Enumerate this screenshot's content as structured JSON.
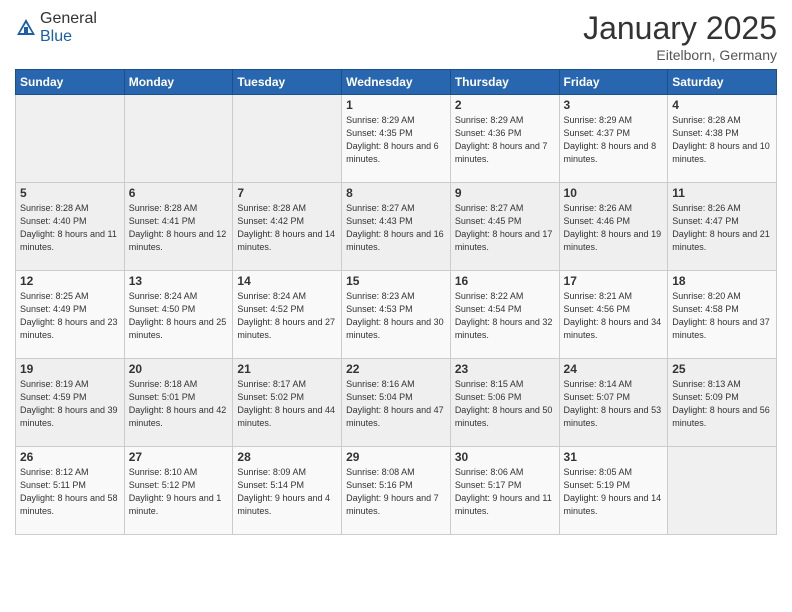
{
  "header": {
    "logo_general": "General",
    "logo_blue": "Blue",
    "month": "January 2025",
    "location": "Eitelborn, Germany"
  },
  "weekdays": [
    "Sunday",
    "Monday",
    "Tuesday",
    "Wednesday",
    "Thursday",
    "Friday",
    "Saturday"
  ],
  "weeks": [
    [
      {
        "day": "",
        "info": ""
      },
      {
        "day": "",
        "info": ""
      },
      {
        "day": "",
        "info": ""
      },
      {
        "day": "1",
        "info": "Sunrise: 8:29 AM\nSunset: 4:35 PM\nDaylight: 8 hours\nand 6 minutes."
      },
      {
        "day": "2",
        "info": "Sunrise: 8:29 AM\nSunset: 4:36 PM\nDaylight: 8 hours\nand 7 minutes."
      },
      {
        "day": "3",
        "info": "Sunrise: 8:29 AM\nSunset: 4:37 PM\nDaylight: 8 hours\nand 8 minutes."
      },
      {
        "day": "4",
        "info": "Sunrise: 8:28 AM\nSunset: 4:38 PM\nDaylight: 8 hours\nand 10 minutes."
      }
    ],
    [
      {
        "day": "5",
        "info": "Sunrise: 8:28 AM\nSunset: 4:40 PM\nDaylight: 8 hours\nand 11 minutes."
      },
      {
        "day": "6",
        "info": "Sunrise: 8:28 AM\nSunset: 4:41 PM\nDaylight: 8 hours\nand 12 minutes."
      },
      {
        "day": "7",
        "info": "Sunrise: 8:28 AM\nSunset: 4:42 PM\nDaylight: 8 hours\nand 14 minutes."
      },
      {
        "day": "8",
        "info": "Sunrise: 8:27 AM\nSunset: 4:43 PM\nDaylight: 8 hours\nand 16 minutes."
      },
      {
        "day": "9",
        "info": "Sunrise: 8:27 AM\nSunset: 4:45 PM\nDaylight: 8 hours\nand 17 minutes."
      },
      {
        "day": "10",
        "info": "Sunrise: 8:26 AM\nSunset: 4:46 PM\nDaylight: 8 hours\nand 19 minutes."
      },
      {
        "day": "11",
        "info": "Sunrise: 8:26 AM\nSunset: 4:47 PM\nDaylight: 8 hours\nand 21 minutes."
      }
    ],
    [
      {
        "day": "12",
        "info": "Sunrise: 8:25 AM\nSunset: 4:49 PM\nDaylight: 8 hours\nand 23 minutes."
      },
      {
        "day": "13",
        "info": "Sunrise: 8:24 AM\nSunset: 4:50 PM\nDaylight: 8 hours\nand 25 minutes."
      },
      {
        "day": "14",
        "info": "Sunrise: 8:24 AM\nSunset: 4:52 PM\nDaylight: 8 hours\nand 27 minutes."
      },
      {
        "day": "15",
        "info": "Sunrise: 8:23 AM\nSunset: 4:53 PM\nDaylight: 8 hours\nand 30 minutes."
      },
      {
        "day": "16",
        "info": "Sunrise: 8:22 AM\nSunset: 4:54 PM\nDaylight: 8 hours\nand 32 minutes."
      },
      {
        "day": "17",
        "info": "Sunrise: 8:21 AM\nSunset: 4:56 PM\nDaylight: 8 hours\nand 34 minutes."
      },
      {
        "day": "18",
        "info": "Sunrise: 8:20 AM\nSunset: 4:58 PM\nDaylight: 8 hours\nand 37 minutes."
      }
    ],
    [
      {
        "day": "19",
        "info": "Sunrise: 8:19 AM\nSunset: 4:59 PM\nDaylight: 8 hours\nand 39 minutes."
      },
      {
        "day": "20",
        "info": "Sunrise: 8:18 AM\nSunset: 5:01 PM\nDaylight: 8 hours\nand 42 minutes."
      },
      {
        "day": "21",
        "info": "Sunrise: 8:17 AM\nSunset: 5:02 PM\nDaylight: 8 hours\nand 44 minutes."
      },
      {
        "day": "22",
        "info": "Sunrise: 8:16 AM\nSunset: 5:04 PM\nDaylight: 8 hours\nand 47 minutes."
      },
      {
        "day": "23",
        "info": "Sunrise: 8:15 AM\nSunset: 5:06 PM\nDaylight: 8 hours\nand 50 minutes."
      },
      {
        "day": "24",
        "info": "Sunrise: 8:14 AM\nSunset: 5:07 PM\nDaylight: 8 hours\nand 53 minutes."
      },
      {
        "day": "25",
        "info": "Sunrise: 8:13 AM\nSunset: 5:09 PM\nDaylight: 8 hours\nand 56 minutes."
      }
    ],
    [
      {
        "day": "26",
        "info": "Sunrise: 8:12 AM\nSunset: 5:11 PM\nDaylight: 8 hours\nand 58 minutes."
      },
      {
        "day": "27",
        "info": "Sunrise: 8:10 AM\nSunset: 5:12 PM\nDaylight: 9 hours\nand 1 minute."
      },
      {
        "day": "28",
        "info": "Sunrise: 8:09 AM\nSunset: 5:14 PM\nDaylight: 9 hours\nand 4 minutes."
      },
      {
        "day": "29",
        "info": "Sunrise: 8:08 AM\nSunset: 5:16 PM\nDaylight: 9 hours\nand 7 minutes."
      },
      {
        "day": "30",
        "info": "Sunrise: 8:06 AM\nSunset: 5:17 PM\nDaylight: 9 hours\nand 11 minutes."
      },
      {
        "day": "31",
        "info": "Sunrise: 8:05 AM\nSunset: 5:19 PM\nDaylight: 9 hours\nand 14 minutes."
      },
      {
        "day": "",
        "info": ""
      }
    ]
  ]
}
